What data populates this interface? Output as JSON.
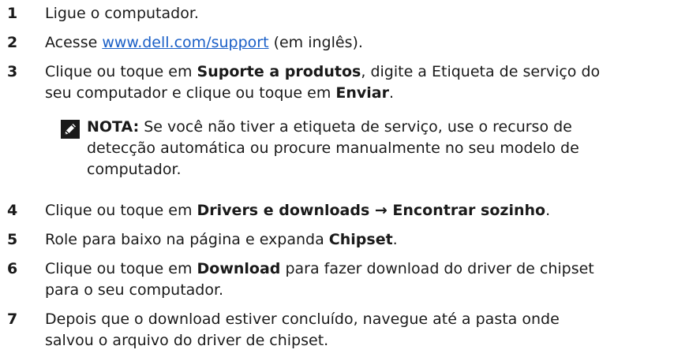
{
  "steps": [
    {
      "num": "1",
      "text": "Ligue o computador."
    },
    {
      "num": "2",
      "pre": "Acesse ",
      "link": "www.dell.com/support",
      "post": " (em inglês)."
    },
    {
      "num": "3",
      "pre": "Clique ou toque em ",
      "b1": "Suporte a produtos",
      "mid": ", digite a Etiqueta de serviço do",
      "line2pre": "seu computador e clique ou toque em ",
      "b2": "Enviar",
      "post": "."
    },
    {
      "num": "4",
      "pre": "Clique ou toque em ",
      "b1": "Drivers e downloads → Encontrar sozinho",
      "post": "."
    },
    {
      "num": "5",
      "pre": "Role para baixo na página e expanda ",
      "b1": "Chipset",
      "post": "."
    },
    {
      "num": "6",
      "pre": "Clique ou toque em ",
      "b1": "Download",
      "mid": " para fazer download do driver de chipset",
      "line2": "para o seu computador."
    },
    {
      "num": "7",
      "line1": "Depois que o download estiver concluído, navegue até a pasta onde",
      "line2": "salvou o arquivo do driver de chipset."
    }
  ],
  "note": {
    "icon": "pencil-icon",
    "label": "NOTA:",
    "line1": " Se você não tiver a etiqueta de serviço, use o recurso de",
    "line2": "detecção automática ou procure manualmente no seu modelo de",
    "line3": "computador."
  },
  "colors": {
    "link": "#1a5fc7",
    "text": "#1a1a1a"
  }
}
